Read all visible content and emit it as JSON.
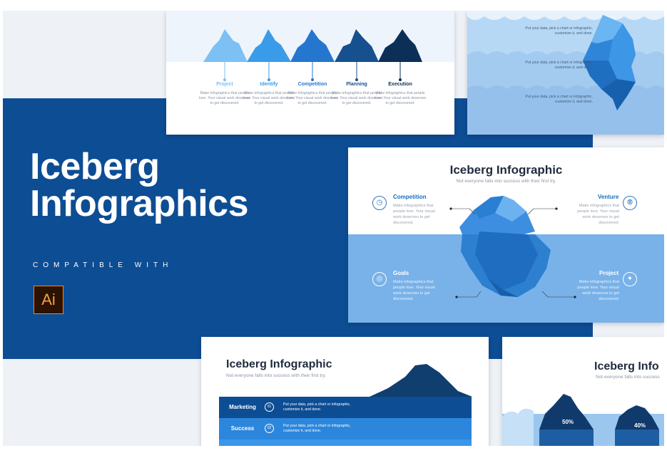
{
  "hero": {
    "title_line1": "Iceberg",
    "title_line2": "Infographics",
    "compatible": "COMPATIBLE WITH",
    "app_badge": "Ai"
  },
  "slide_steps": {
    "steps": [
      {
        "label": "Project",
        "color": "#7cc0f4"
      },
      {
        "label": "Identify",
        "color": "#3a9be8"
      },
      {
        "label": "Competition",
        "color": "#2476cf"
      },
      {
        "label": "Planning",
        "color": "#16508f"
      },
      {
        "label": "Execution",
        "color": "#0c2f57"
      }
    ],
    "desc": "Make infographics that people love. Your visual work deserves to get discovered."
  },
  "slide_water": {
    "texts": [
      "Put your data, pick a chart or infographic, customize it, and done.",
      "Put your data, pick a chart or infographic, customize it, and done.",
      "Put your data, pick a chart or infographic, customize it, and done."
    ]
  },
  "slide_main": {
    "title": "Iceberg Infographic",
    "subtitle": "Not everyone falls into success with their first try.",
    "items": [
      {
        "title": "Competition",
        "text": "Make infographics that people love. Your visual work deserves to get discovered."
      },
      {
        "title": "Venture",
        "text": "Make infographics that people love. Your visual work deserves to get discovered."
      },
      {
        "title": "Goals",
        "text": "Make infographics that people love. Your visual work deserves to get discovered."
      },
      {
        "title": "Project",
        "text": "Make infographics that people love. Your visual work deserves to get discovered."
      }
    ]
  },
  "slide_rows": {
    "title": "Iceberg Infographic",
    "subtitle": "Not everyone falls into success with their first try.",
    "rows": [
      {
        "name": "Marketing",
        "num": "01",
        "text": "Put your data, pick a chart or infographic, customize it, and done.",
        "color": "#0d4d94"
      },
      {
        "name": "Success",
        "num": "02",
        "text": "Put your data, pick a chart or infographic, customize it, and done.",
        "color": "#2c86dc"
      }
    ]
  },
  "slide_pct": {
    "title": "Iceberg Info",
    "subtitle": "Not everyone falls into success",
    "values": [
      "50%",
      "40%"
    ]
  },
  "colors": {
    "band": "#0d4d94",
    "accent": "#1a6dbd",
    "ai_orange": "#f08a1f"
  }
}
